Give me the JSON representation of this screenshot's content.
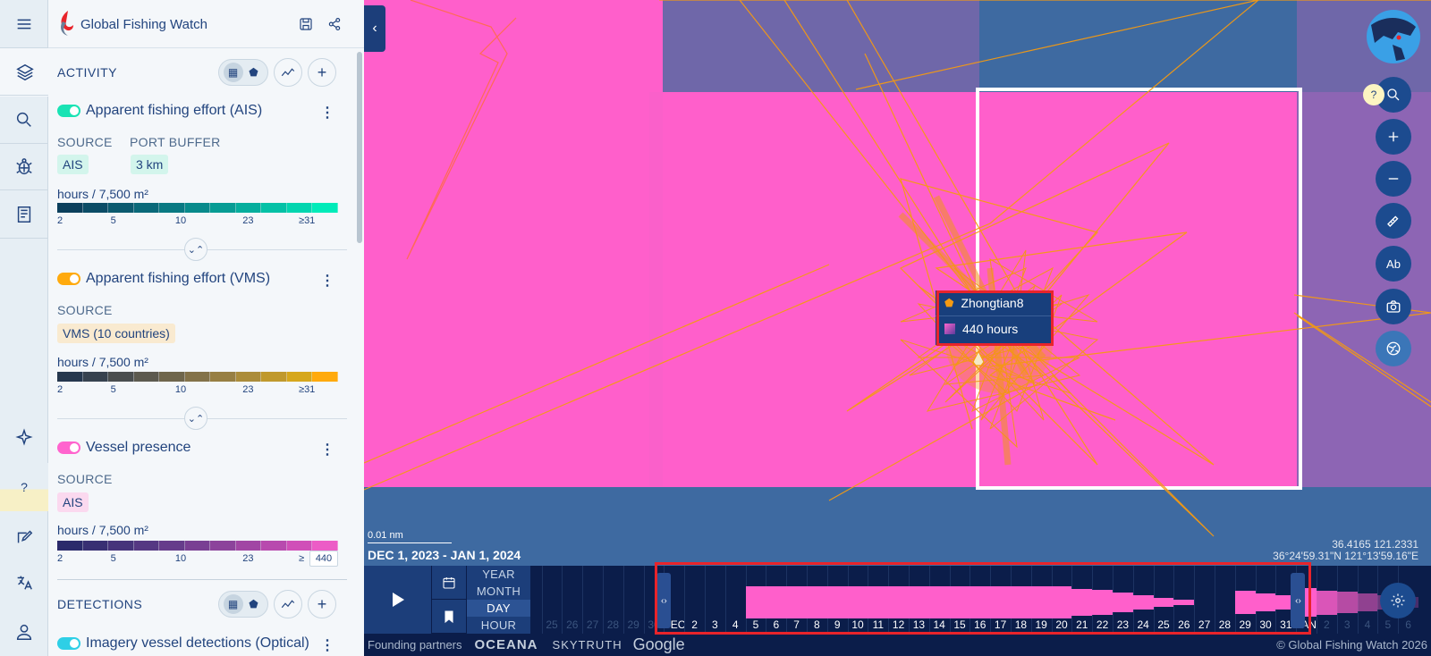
{
  "app": {
    "title": "Global Fishing Watch"
  },
  "rail": {
    "icons": [
      "menu-icon",
      "layers-icon",
      "search-icon",
      "turtle-icon",
      "reports-icon",
      "sparkle-icon",
      "help-icon",
      "feedback-icon",
      "language-icon",
      "user-icon"
    ],
    "help_label": "?"
  },
  "activity": {
    "title": "ACTIVITY",
    "add_label": "+",
    "layers": [
      {
        "title": "Apparent fishing effort (AIS)",
        "toggle_color": "#19e3b4",
        "source_label": "SOURCE",
        "buffer_label": "PORT BUFFER",
        "source_chip": "AIS",
        "buffer_chip": "3 km",
        "unit": "hours / 7,500 m²",
        "ticks": [
          "2",
          "5",
          "10",
          "23",
          "≥31"
        ],
        "ramp": [
          "#0b3f5c",
          "#0b4c66",
          "#0b5a6f",
          "#0a6979",
          "#097982",
          "#088a8b",
          "#079c94",
          "#05ae9d",
          "#04c1a6",
          "#02d5af",
          "#00ebb9"
        ]
      },
      {
        "title": "Apparent fishing effort (VMS)",
        "toggle_color": "#ffaa0d",
        "source_label": "SOURCE",
        "source_chip": "VMS (10 countries)",
        "unit": "hours / 7,500 m²",
        "ticks": [
          "2",
          "5",
          "10",
          "23",
          "≥31"
        ],
        "ramp": [
          "#26374e",
          "#37424f",
          "#4a4e4f",
          "#5c5a4f",
          "#6f664c",
          "#837249",
          "#977f43",
          "#ab8c3a",
          "#c0992d",
          "#d6a71c",
          "#ffaa0d"
        ]
      },
      {
        "title": "Vessel presence",
        "toggle_color": "#ff64ce",
        "source_label": "SOURCE",
        "source_chip": "AIS",
        "unit": "hours / 7,500 m²",
        "ticks": [
          "2",
          "5",
          "10",
          "23",
          "≥"
        ],
        "ramp": [
          "#2b2a6b",
          "#382f73",
          "#46347b",
          "#553883",
          "#663c8b",
          "#793f93",
          "#8c439b",
          "#a146a4",
          "#b84aae",
          "#d04fb8",
          "#ec5cc6"
        ],
        "hover_value": "440"
      }
    ]
  },
  "detections": {
    "title": "DETECTIONS",
    "add_label": "+",
    "layers": [
      {
        "title": "Imagery vessel detections (Optical)",
        "toggle_color": "#2ecfe6"
      }
    ]
  },
  "map": {
    "tooltip": {
      "vessel_name": "Zhongtian8",
      "hours": "440 hours"
    },
    "scale": "0.01 nm",
    "date_range": "DEC 1, 2023 - JAN 1, 2024",
    "coords_decimal": "36.4165 121.2331",
    "coords_dms": "36°24'59.31\"N 121°13'59.16\"E",
    "help_label": "?"
  },
  "timebar": {
    "resolutions": [
      "YEAR",
      "MONTH",
      "DAY",
      "HOUR"
    ],
    "active_resolution": "DAY",
    "day_labels": [
      "25",
      "26",
      "27",
      "28",
      "29",
      "30",
      "DEC",
      "2",
      "3",
      "4",
      "5",
      "6",
      "7",
      "8",
      "9",
      "10",
      "11",
      "12",
      "13",
      "14",
      "15",
      "16",
      "17",
      "18",
      "19",
      "20",
      "21",
      "22",
      "23",
      "24",
      "25",
      "26",
      "27",
      "28",
      "29",
      "30",
      "31",
      "JAN",
      "2",
      "3",
      "4",
      "5",
      "6"
    ],
    "activity_fraction": [
      0,
      0,
      0,
      0,
      0,
      0,
      0,
      0,
      0,
      0,
      1,
      1,
      1,
      1,
      1,
      1,
      1,
      1,
      1,
      1,
      1,
      1,
      1,
      1,
      1,
      1,
      0.85,
      0.78,
      0.62,
      0.42,
      0.28,
      0.15,
      0,
      0,
      0.7,
      0.55,
      0.45,
      0.9,
      0.75,
      0.65,
      0.55,
      0.45,
      0.35
    ],
    "handle_label": "‹›"
  },
  "footer": {
    "partners_label": "Founding partners",
    "partner1": "OCEANA",
    "partner2": "SKYTRUTH",
    "partner3": "Google",
    "copyright": "© Global Fishing Watch 2026"
  },
  "colors": {
    "vessel_presence": "#ff5fcb",
    "track": "#f59a12",
    "highlight": "#e8242b"
  }
}
